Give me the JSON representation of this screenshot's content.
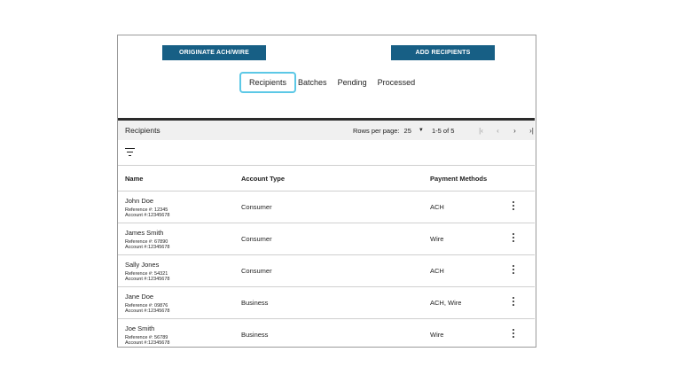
{
  "buttons": {
    "originate": "ORIGINATE ACH/WIRE",
    "add_recipients": "ADD RECIPIENTS"
  },
  "tabs": [
    {
      "label": "Recipients",
      "active": true
    },
    {
      "label": "Batches",
      "active": false
    },
    {
      "label": "Pending",
      "active": false
    },
    {
      "label": "Processed",
      "active": false
    }
  ],
  "table": {
    "title": "Recipients",
    "rows_per_page_label": "Rows per page:",
    "rows_per_page_value": "25",
    "range": "1-5 of 5",
    "columns": {
      "name": "Name",
      "account_type": "Account Type",
      "payment_methods": "Payment Methods"
    },
    "rows": [
      {
        "name": "John Doe",
        "reference": "Reference #: 12345",
        "account": "Account #:12345678",
        "account_type": "Consumer",
        "payment": "ACH"
      },
      {
        "name": "James Smith",
        "reference": "Reference #: 67890",
        "account": "Account #:12345678",
        "account_type": "Consumer",
        "payment": "Wire"
      },
      {
        "name": "Sally Jones",
        "reference": "Reference #: 54321",
        "account": "Account #:12345678",
        "account_type": "Consumer",
        "payment": "ACH"
      },
      {
        "name": "Jane Doe",
        "reference": "Reference #: 09876",
        "account": "Account #:12345678",
        "account_type": "Business",
        "payment": "ACH, Wire"
      },
      {
        "name": "Joe Smith",
        "reference": "Reference #: 56789",
        "account": "Account #:12345678",
        "account_type": "Business",
        "payment": "Wire"
      }
    ]
  },
  "icons": {
    "first_page": "first-page-icon",
    "prev_page": "chevron-left-icon",
    "next_page": "chevron-right-icon",
    "last_page": "last-page-icon",
    "filter": "filter-icon",
    "more": "more-vert-icon",
    "dropdown": "caret-down-icon"
  },
  "colors": {
    "button_bg": "#175f85",
    "active_tab_outline": "#5cc8e6",
    "toolbar_bg": "#f0f0f0"
  }
}
